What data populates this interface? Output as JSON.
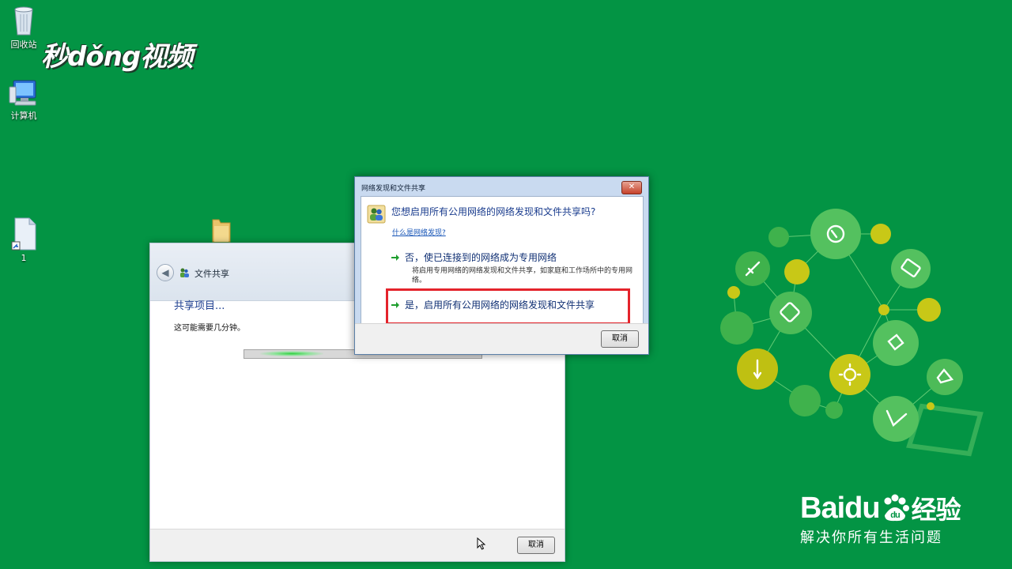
{
  "desktop": {
    "icons": [
      {
        "label": "回收站",
        "icon": "recycle-bin-icon"
      },
      {
        "label": "计算机",
        "icon": "computer-icon"
      },
      {
        "label": "1",
        "icon": "document-icon"
      }
    ]
  },
  "watermark": {
    "text": "秒dǒng视频"
  },
  "share_window": {
    "title": "文件共享",
    "heading": "共享项目...",
    "subtext": "这可能需要几分钟。",
    "cancel_label": "取消"
  },
  "dialog": {
    "title": "网络发现和文件共享",
    "close_label": "✕",
    "question": "您想启用所有公用网络的网络发现和文件共享吗?",
    "help_link": "什么是网络发现?",
    "option_no_title": "否，使已连接到的网络成为专用网络",
    "option_no_desc": "将启用专用网络的网络发现和文件共享，如家庭和工作场所中的专用网络。",
    "option_yes_title": "是，启用所有公用网络的网络发现和文件共享",
    "cancel_label": "取消"
  },
  "branding": {
    "baidu_logo": "Baidu",
    "baidu_jingyan": "经验",
    "slogan": "解决你所有生活问题"
  },
  "colors": {
    "desktop_bg": "#039444",
    "highlight": "#e4232b",
    "link": "#1a57b8",
    "heading": "#1b3d8f"
  }
}
